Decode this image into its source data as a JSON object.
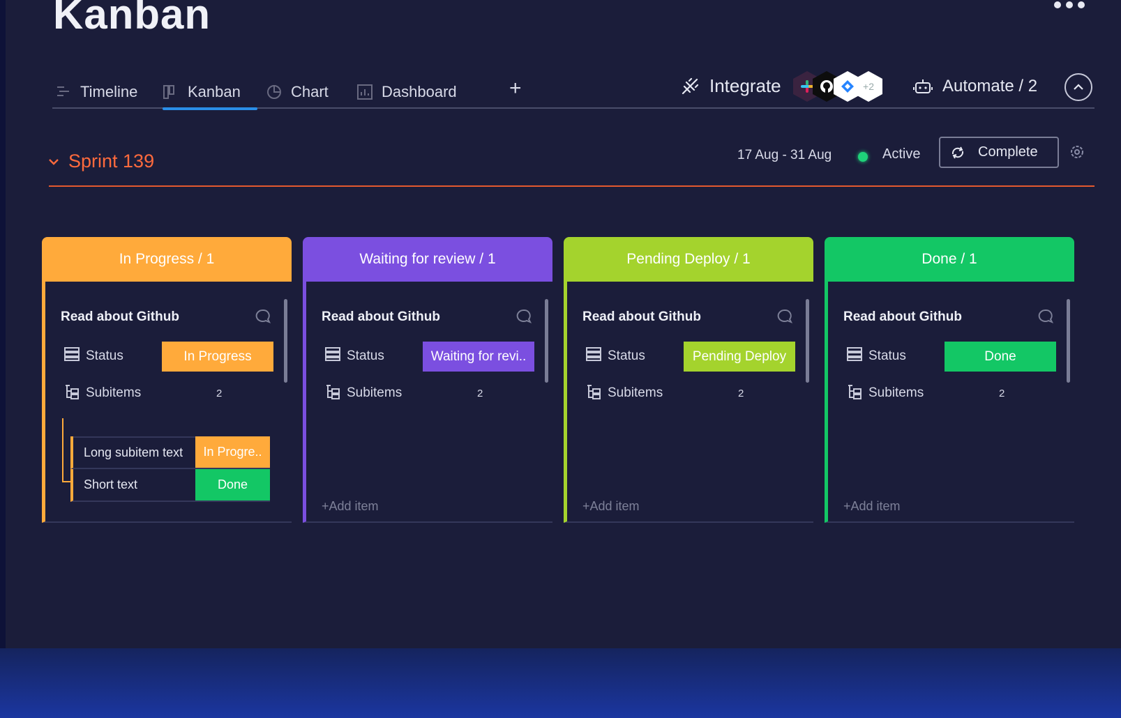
{
  "page": {
    "title": "Kanban"
  },
  "tabs": [
    {
      "label": "Timeline",
      "icon": "timeline-icon"
    },
    {
      "label": "Kanban",
      "icon": "kanban-icon",
      "active": true
    },
    {
      "label": "Chart",
      "icon": "chart-icon"
    },
    {
      "label": "Dashboard",
      "icon": "dashboard-icon"
    }
  ],
  "integrate": {
    "label": "Integrate",
    "extra_count": "+2"
  },
  "automate": {
    "label": "Automate / 2"
  },
  "sprint": {
    "title": "Sprint 139",
    "date_range": "17 Aug - 31 Aug",
    "state": "Active",
    "complete_label": "Complete"
  },
  "colors": {
    "in_progress": "#ffaa3b",
    "waiting": "#7b4fe0",
    "pending": "#a4d32d",
    "done": "#13c765",
    "sprint_accent": "#ff6a3d",
    "active_tab": "#2a8ee8"
  },
  "columns": [
    {
      "header": "In Progress / 1",
      "card": {
        "title": "Read about Github",
        "status_label": "Status",
        "status_value": "In Progress",
        "subitems_label": "Subitems",
        "subitems_count": "2"
      },
      "subitems": [
        {
          "name": "Long subitem text",
          "status": "In Progre.."
        },
        {
          "name": "Short text",
          "status": "Done"
        }
      ]
    },
    {
      "header": "Waiting for review / 1",
      "card": {
        "title": "Read about Github",
        "status_label": "Status",
        "status_value": "Waiting for revi..",
        "subitems_label": "Subitems",
        "subitems_count": "2"
      },
      "add_item": "+Add item"
    },
    {
      "header": "Pending Deploy / 1",
      "card": {
        "title": "Read about Github",
        "status_label": "Status",
        "status_value": "Pending Deploy",
        "subitems_label": "Subitems",
        "subitems_count": "2"
      },
      "add_item": "+Add item"
    },
    {
      "header": "Done / 1",
      "card": {
        "title": "Read about Github",
        "status_label": "Status",
        "status_value": "Done",
        "subitems_label": "Subitems",
        "subitems_count": "2"
      },
      "add_item": "+Add item"
    }
  ]
}
